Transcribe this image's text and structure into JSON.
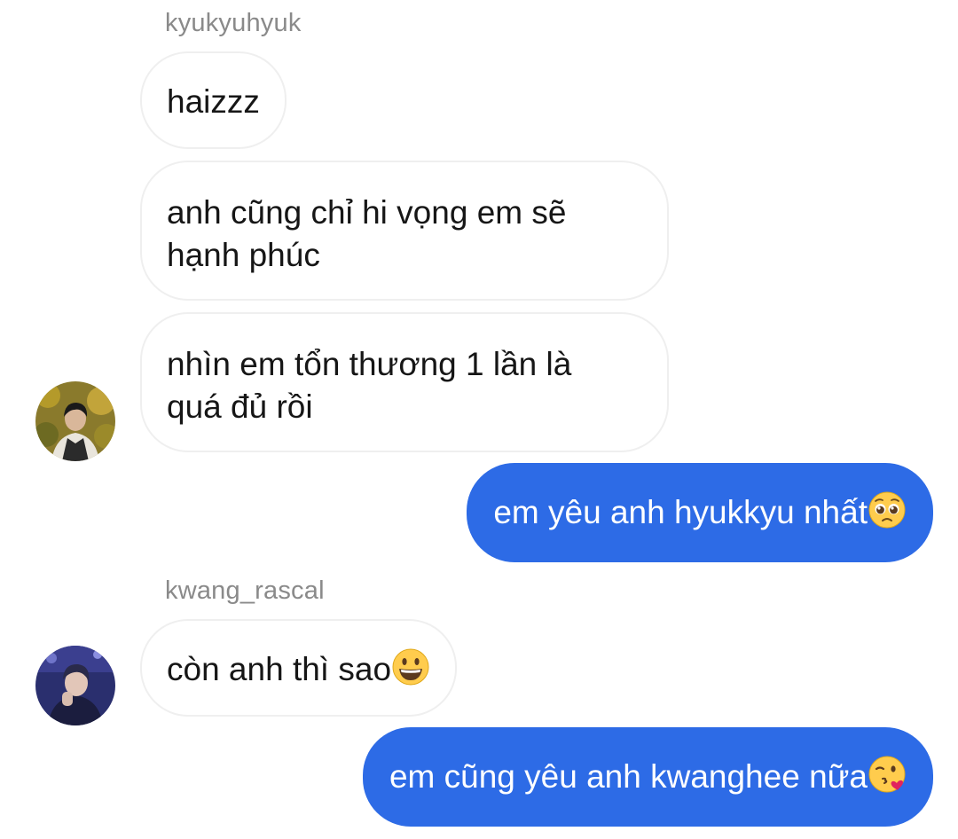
{
  "thread": {
    "group1": {
      "sender": "kyukyuhyuk",
      "messages": [
        "haizzz",
        "anh cũng chỉ hi vọng em sẽ",
        "hạnh phúc",
        "nhìn em tổn thương 1 lần là",
        "quá đủ rồi"
      ]
    },
    "reply1": {
      "text": "em yêu anh hyukkyu nhất",
      "emoji": "pleading-face"
    },
    "group2": {
      "sender": "kwang_rascal",
      "text": "còn anh thì sao",
      "emoji": "grinning-face"
    },
    "reply2": {
      "text": "em cũng yêu anh kwanghee nữa",
      "emoji": "face-blowing-kiss"
    }
  },
  "colors": {
    "outgoing_bubble": "#2d6be6",
    "incoming_border": "#efefef",
    "sender_name": "#8a8a8a"
  }
}
